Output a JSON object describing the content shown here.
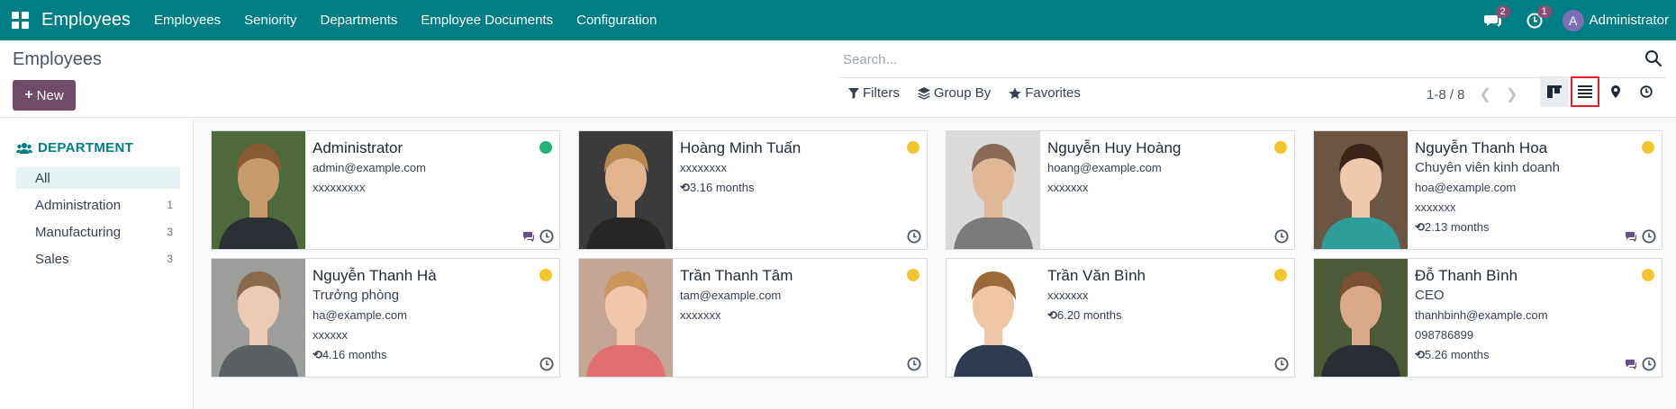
{
  "navbar": {
    "app_name": "Employees",
    "menu": [
      "Employees",
      "Seniority",
      "Departments",
      "Employee Documents",
      "Configuration"
    ],
    "messages_count": "2",
    "activities_count": "1",
    "user_initial": "A",
    "user_name": "Administrator"
  },
  "control_panel": {
    "title": "Employees",
    "new_label": "New",
    "search_placeholder": "Search...",
    "filters_label": "Filters",
    "group_by_label": "Group By",
    "favorites_label": "Favorites",
    "pager": "1-8 / 8"
  },
  "sidebar": {
    "header": "DEPARTMENT",
    "items": [
      {
        "label": "All",
        "count": ""
      },
      {
        "label": "Administration",
        "count": "1"
      },
      {
        "label": "Manufacturing",
        "count": "3"
      },
      {
        "label": "Sales",
        "count": "3"
      }
    ]
  },
  "employees": [
    {
      "name": "Administrator",
      "job": "",
      "email": "admin@example.com",
      "phone": "xxxxxxxxx",
      "seniority": "",
      "status": "green",
      "chat": true
    },
    {
      "name": "Hoàng Minh Tuấn",
      "job": "",
      "email": "",
      "phone": "xxxxxxxx",
      "seniority": "3.16 months",
      "status": "yellow",
      "chat": false
    },
    {
      "name": "Nguyễn Huy Hoàng",
      "job": "",
      "email": "hoang@example.com",
      "phone": "xxxxxxx",
      "seniority": "",
      "status": "yellow",
      "chat": false
    },
    {
      "name": "Nguyễn Thanh Hoa",
      "job": "Chuyên viên kinh doanh",
      "email": "hoa@example.com",
      "phone": "xxxxxxx",
      "seniority": "2.13 months",
      "status": "yellow",
      "chat": true
    },
    {
      "name": "Nguyễn Thanh Hà",
      "job": "Trưởng phòng",
      "email": "ha@example.com",
      "phone": "xxxxxx",
      "seniority": "4.16 months",
      "status": "yellow",
      "chat": false
    },
    {
      "name": "Trần Thanh Tâm",
      "job": "",
      "email": "tam@example.com",
      "phone": "xxxxxxx",
      "seniority": "",
      "status": "yellow",
      "chat": false
    },
    {
      "name": "Trần Văn Bình",
      "job": "",
      "email": "",
      "phone": "xxxxxxx",
      "seniority": "6.20 months",
      "status": "yellow",
      "chat": false
    },
    {
      "name": "Đỗ Thanh Bình",
      "job": "CEO",
      "email": "thanhbinh@example.com",
      "phone": "098786899",
      "seniority": "5.26 months",
      "status": "yellow",
      "chat": true
    }
  ],
  "colors": {
    "navbar": "#017e84",
    "primary_button": "#714b67",
    "status_green": "#21b37a",
    "status_yellow": "#f3c52f"
  }
}
